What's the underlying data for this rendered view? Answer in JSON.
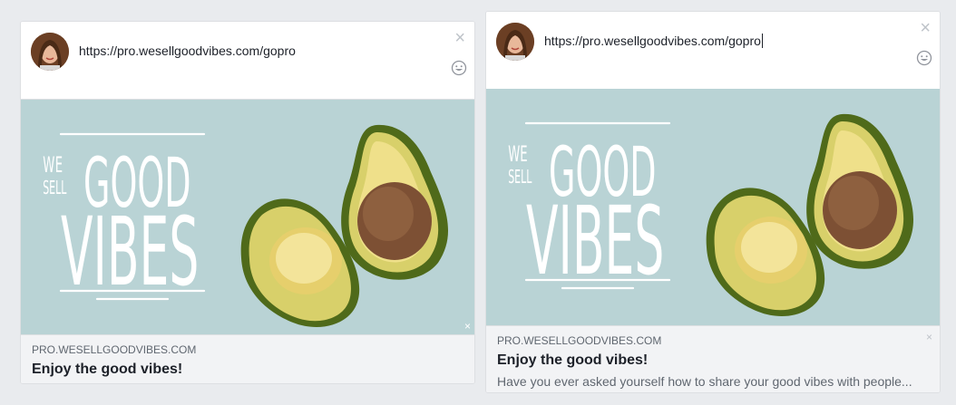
{
  "left_card": {
    "url_value": "https://pro.wesellgoodvibes.com/gopro",
    "close_label": "×",
    "preview": {
      "domain": "PRO.WESELLGOODVIBES.COM",
      "headline": "Enjoy the good vibes!"
    },
    "image_remove_label": "×"
  },
  "right_card": {
    "url_value": "https://pro.wesellgoodvibes.com/gopro",
    "close_label": "×",
    "preview": {
      "domain": "PRO.WESELLGOODVIBES.COM",
      "headline": "Enjoy the good vibes!",
      "description": "Have you ever asked yourself how to share your good vibes with people..."
    },
    "meta_remove_label": "×"
  },
  "logo": {
    "line1_small": "WE",
    "line1_big": "GOOD",
    "line2_small": "SELL",
    "line3_big": "VIBES"
  },
  "colors": {
    "page_bg": "#e9ebee",
    "image_bg": "#b9d3d5",
    "avocado_skin": "#4f6a1a",
    "avocado_flesh": "#e8d77a",
    "avocado_pit": "#8a5a3a"
  }
}
